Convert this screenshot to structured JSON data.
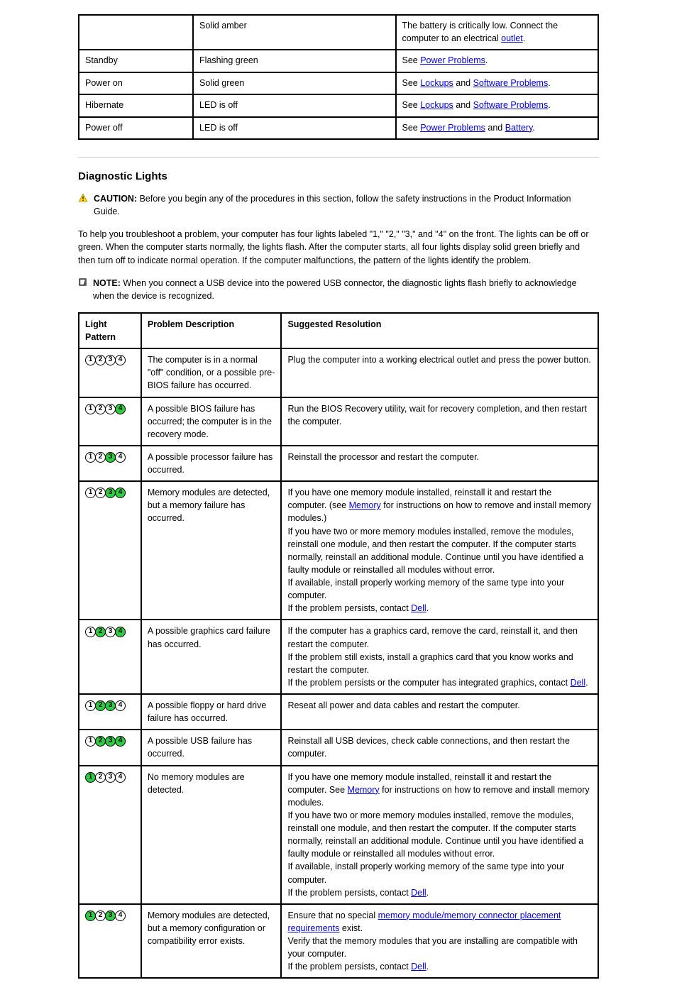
{
  "top_table": {
    "rows": [
      {
        "c2": "Solid amber",
        "c3_before": "The battery is critically low. Connect the computer to an electrical ",
        "c3_link": "outlet",
        "c3_after": "."
      },
      {
        "c1": "Standby",
        "c2": "Flashing green",
        "c3_before": "See ",
        "c3_link": "Power Problems",
        "c3_after": "."
      },
      {
        "c1": "Power on",
        "c2": "Solid green",
        "c3_before": "See ",
        "c3_link_a": "Lockups",
        "c3_mid": " and ",
        "c3_link_b": "Software Problems",
        "c3_after": "."
      },
      {
        "c1": "Hibernate",
        "c2": "LED is off",
        "c3_before": "See ",
        "c3_link_a": "Lockups",
        "c3_mid": " and ",
        "c3_link_b": "Software Problems",
        "c3_after": "."
      },
      {
        "c1": "Power off",
        "c2": "LED is off",
        "c3_before": "See ",
        "c3_link_a": "Power Problems",
        "c3_mid": " and ",
        "c3_link_b": "Battery",
        "c3_after": "."
      }
    ]
  },
  "section_title": "Diagnostic Lights",
  "caution": {
    "label": "CAUTION:",
    "text": " Before you begin any of the procedures in this section, follow the safety instructions in the Product Information Guide."
  },
  "note": {
    "label": "NOTE:",
    "text": " When you connect a USB device into the powered USB connector, the diagnostic lights flash briefly to acknowledge when the device is recognized."
  },
  "table_intro": "To help you troubleshoot a problem, your computer has four lights labeled \"1,\" \"2,\" \"3,\" and \"4\" on the front. The lights can be off or green. When the computer starts normally, the lights flash. After the computer starts, all four lights display solid green briefly and then turn off to indicate normal operation. If the computer malfunctions, the pattern of the lights identify the problem.",
  "diag_table": {
    "headers": {
      "pattern": "Light Pattern",
      "desc": "Problem Description",
      "res": "Suggested Resolution"
    },
    "rows": [
      {
        "lights": [
          0,
          0,
          0,
          0
        ],
        "desc": "The computer is in a normal \"off\" condition, or a possible pre-BIOS failure has occurred.",
        "res_parts": [
          {
            "t": "Plug the computer into a working electrical outlet and press the power button."
          }
        ]
      },
      {
        "lights": [
          0,
          0,
          0,
          1
        ],
        "desc": "A possible BIOS failure has occurred; the computer is in the recovery mode.",
        "res_parts": [
          {
            "t": "Run the BIOS Recovery utility, wait for recovery completion, and then restart the computer."
          }
        ]
      },
      {
        "lights": [
          0,
          0,
          1,
          0
        ],
        "desc": "A possible processor failure has occurred.",
        "res_parts": [
          {
            "t": "Reinstall the processor and restart the computer."
          }
        ]
      },
      {
        "lights": [
          0,
          0,
          1,
          1
        ],
        "desc": "Memory modules are detected, but a memory failure has occurred.",
        "res_parts": [
          {
            "t": "If you have one memory module installed, reinstall it and restart the computer. (see "
          },
          {
            "link": "Memory"
          },
          {
            "t": " for instructions on how to remove and install memory modules.)\nIf you have two or more memory modules installed, remove the modules, reinstall one module, and then restart the computer. If the computer starts normally, reinstall an additional module. Continue until you have identified a faulty module or reinstalled all modules without error.\nIf available, install properly working memory of the same type into your computer.\nIf the problem persists, contact "
          },
          {
            "link": "Dell"
          },
          {
            "t": "."
          }
        ]
      },
      {
        "lights": [
          0,
          1,
          0,
          1
        ],
        "desc": "A possible graphics card failure has occurred.",
        "res_parts": [
          {
            "t": "If the computer has a graphics card, remove the card, reinstall it, and then restart the computer.\nIf the problem still exists, install a graphics card that you know works and restart the computer.\nIf the problem persists or the computer has integrated graphics, contact "
          },
          {
            "link": "Dell"
          },
          {
            "t": "."
          }
        ]
      },
      {
        "lights": [
          0,
          1,
          1,
          0
        ],
        "desc": "A possible floppy or hard drive failure has occurred.",
        "res_parts": [
          {
            "t": "Reseat all power and data cables and restart the computer."
          }
        ]
      },
      {
        "lights": [
          0,
          1,
          1,
          1
        ],
        "desc": "A possible USB failure has occurred.",
        "res_parts": [
          {
            "t": "Reinstall all USB devices, check cable connections, and then restart the computer."
          }
        ]
      },
      {
        "lights": [
          1,
          0,
          0,
          0
        ],
        "desc": "No memory modules are detected.",
        "res_parts": [
          {
            "t": "If you have one memory module installed, reinstall it and restart the computer. See "
          },
          {
            "link": "Memory"
          },
          {
            "t": " for instructions on how to remove and install memory modules.\nIf you have two or more memory modules installed, remove the modules, reinstall one module, and then restart the computer. If the computer starts normally, reinstall an additional module. Continue until you have identified a faulty module or reinstalled all modules without error.\nIf available, install properly working memory of the same type into your computer.\nIf the problem persists, contact "
          },
          {
            "link": "Dell"
          },
          {
            "t": "."
          }
        ]
      },
      {
        "lights": [
          1,
          0,
          1,
          0
        ],
        "desc": "Memory modules are detected, but a memory configuration or compatibility error exists.",
        "res_parts": [
          {
            "t": "Ensure that no special "
          },
          {
            "link": "memory module/memory connector placement requirements"
          },
          {
            "t": " exist.\nVerify that the memory modules that you are installing are compatible with your computer.\nIf the problem persists, contact "
          },
          {
            "link": "Dell"
          },
          {
            "t": "."
          }
        ]
      }
    ]
  }
}
